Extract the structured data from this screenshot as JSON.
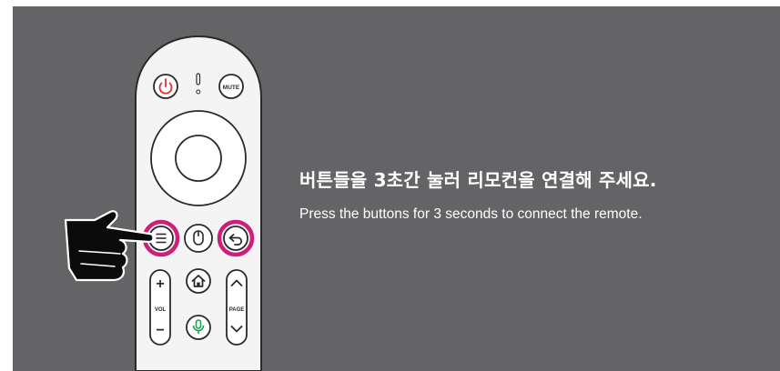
{
  "heading": "버튼들을 3초간 눌러 리모컨을 연결해 주세요.",
  "subheading": "Press the buttons for 3 seconds to connect the remote.",
  "remote": {
    "mute_label": "MUTE",
    "vol_label": "VOL",
    "page_label": "PAGE",
    "plus_glyph": "+",
    "minus_glyph": "−"
  },
  "colors": {
    "background": "#646467",
    "remote_body": "#f4f4f4",
    "highlight_ring": "#cc1f7a",
    "power_icon": "#e0302f",
    "mic_icon": "#1aa34a",
    "text": "#ffffff"
  },
  "icons": [
    "power-icon",
    "indicator-icon",
    "menu-icon",
    "mouse-icon",
    "back-icon",
    "home-icon",
    "mic-icon",
    "chevron-up-icon",
    "chevron-down-icon",
    "pointing-hand-icon"
  ]
}
